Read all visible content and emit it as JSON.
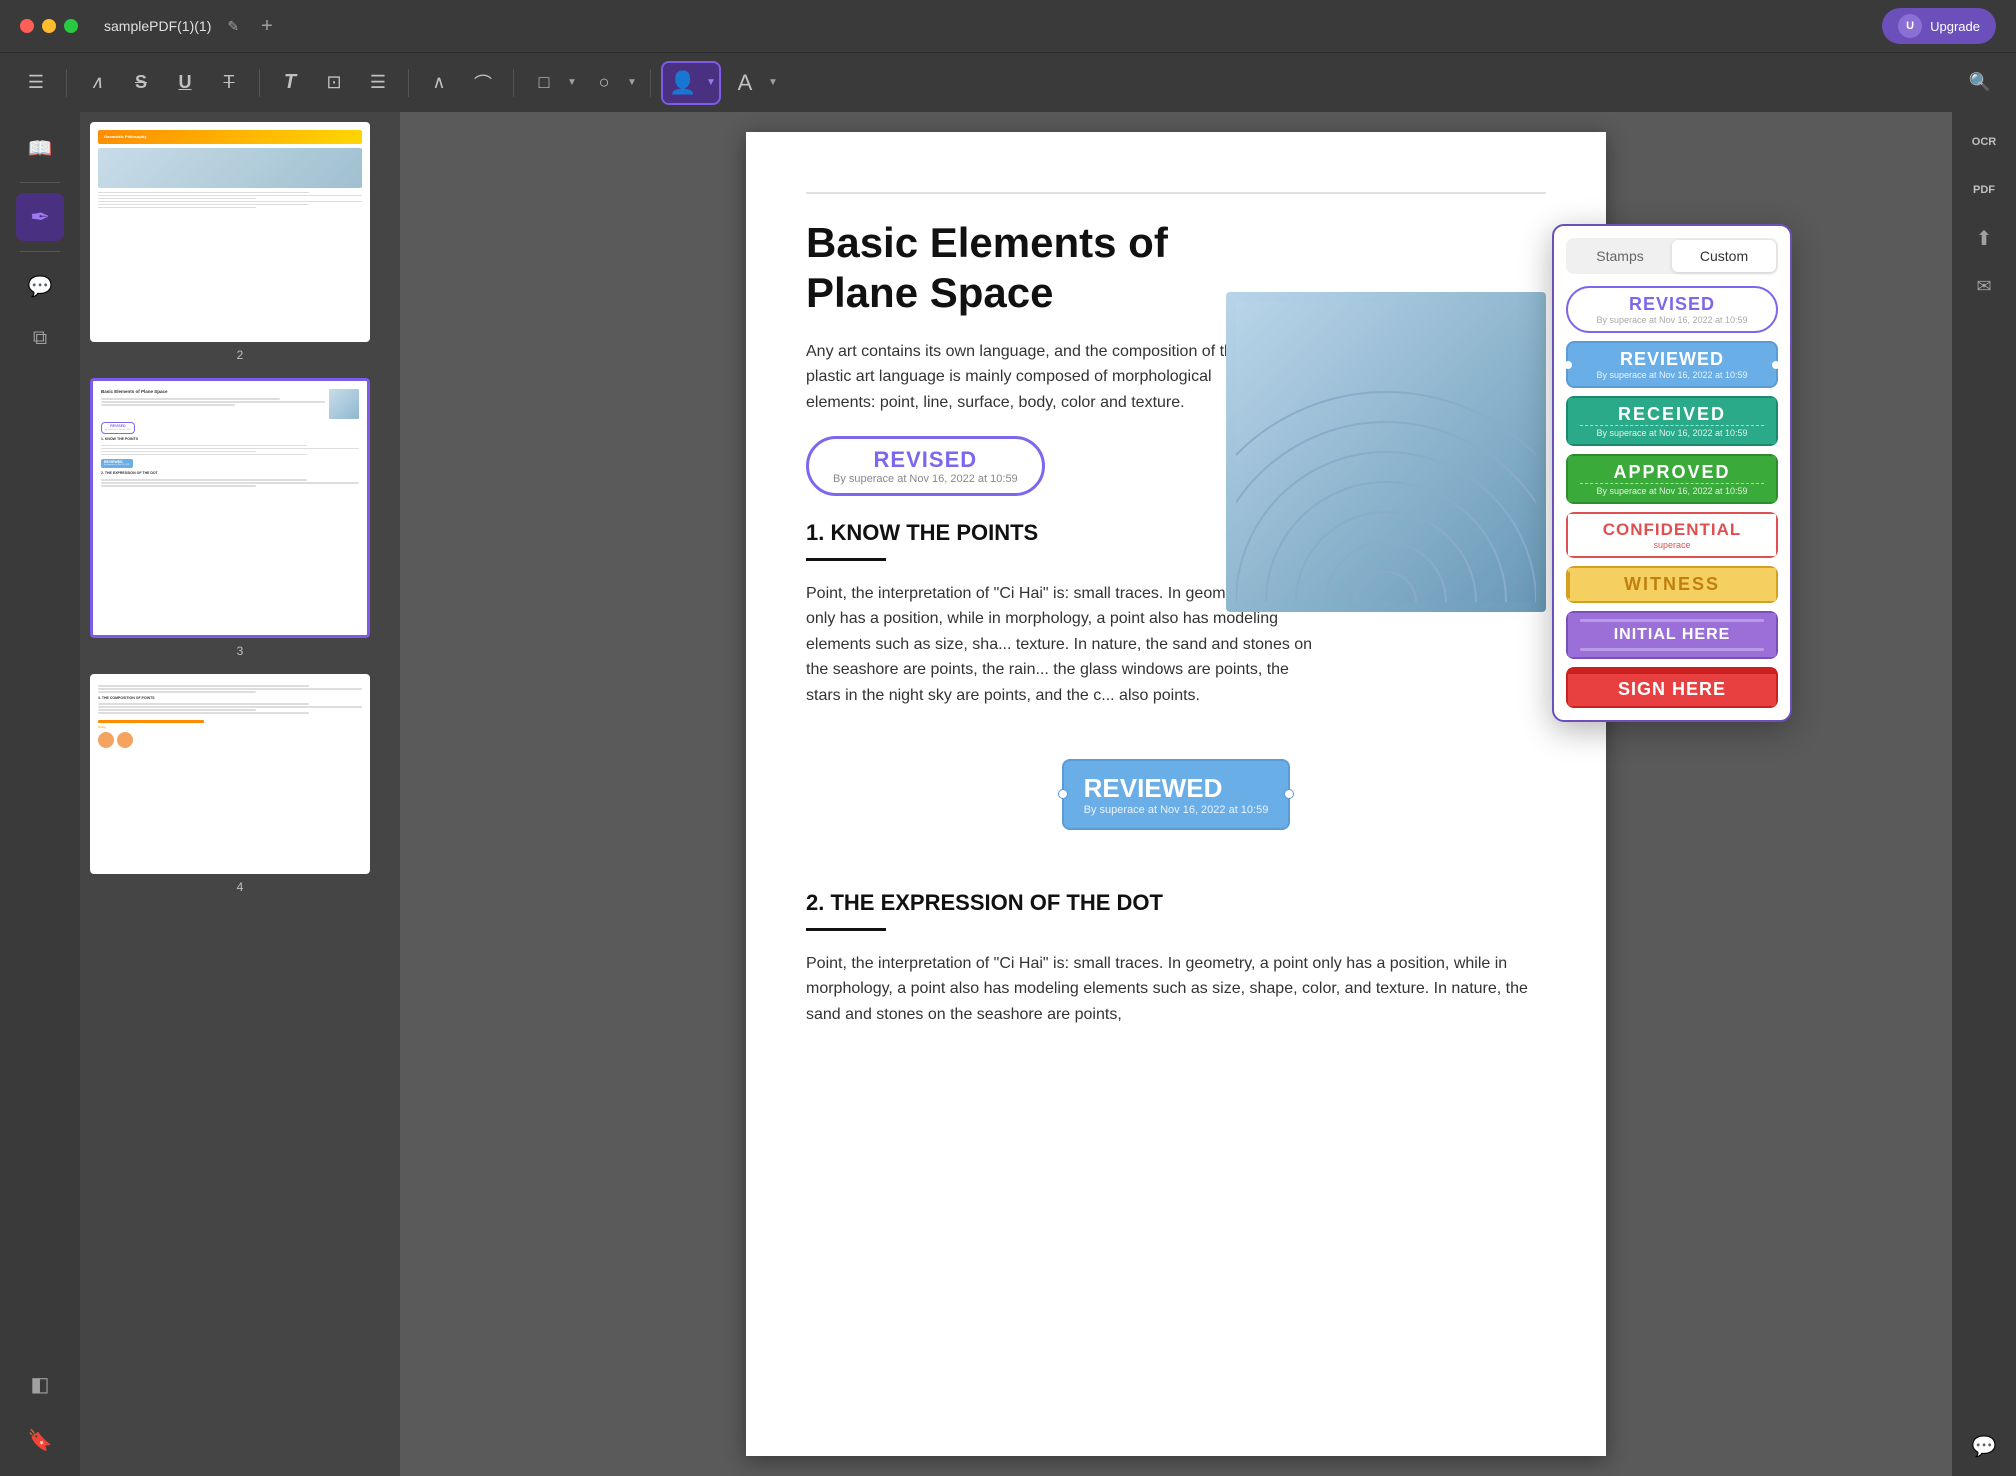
{
  "titlebar": {
    "title": "samplePDF(1)(1)",
    "edit_icon": "✎",
    "add_tab": "+",
    "upgrade_label": "Upgrade",
    "avatar_initial": "U"
  },
  "toolbar": {
    "tools": [
      {
        "name": "comment-tool",
        "icon": "☰",
        "active": false
      },
      {
        "name": "highlight-tool",
        "icon": "✏",
        "active": false
      },
      {
        "name": "strikethrough-tool",
        "icon": "S",
        "active": false
      },
      {
        "name": "underline-tool",
        "icon": "U",
        "active": false
      },
      {
        "name": "typewriter-tool",
        "icon": "T",
        "active": false
      },
      {
        "name": "text-tool",
        "icon": "T",
        "active": false
      },
      {
        "name": "textbox-tool",
        "icon": "⊡",
        "active": false
      },
      {
        "name": "note-tool",
        "icon": "≡",
        "active": false
      },
      {
        "name": "pencil-tool",
        "icon": "∧",
        "active": false
      },
      {
        "name": "shape-tool",
        "icon": "⬡",
        "active": false
      },
      {
        "name": "rectangle-tool",
        "icon": "□",
        "active": false
      },
      {
        "name": "color-tool",
        "icon": "○",
        "active": false
      },
      {
        "name": "stamp-tool",
        "icon": "👤",
        "active": true
      },
      {
        "name": "signature-tool",
        "icon": "A",
        "active": false
      },
      {
        "name": "search-tool",
        "icon": "🔍",
        "active": false
      }
    ]
  },
  "sidebar": {
    "items": [
      {
        "name": "reader-icon",
        "icon": "📖",
        "active": false
      },
      {
        "name": "highlighter-icon",
        "icon": "✒",
        "active": true
      },
      {
        "name": "comment-icon",
        "icon": "💬",
        "active": false
      },
      {
        "name": "layers-icon",
        "icon": "⧉",
        "active": false
      },
      {
        "name": "bookmark-icon",
        "icon": "🔖",
        "active": false
      }
    ]
  },
  "thumbnails": [
    {
      "page_num": "2",
      "active": false
    },
    {
      "page_num": "3",
      "active": true
    },
    {
      "page_num": "4",
      "active": false
    }
  ],
  "pdf": {
    "title": "Basic Elements of Plane Space",
    "body1": "Any art contains its own language, and the composition of the plastic art language is mainly composed of morphological elements: point, line, surface, body, color and texture.",
    "stamp_revised_title": "REVISED",
    "stamp_revised_sub": "By superace at Nov 16, 2022 at 10:59",
    "section1_title": "1. KNOW THE POINTS",
    "section1_body": "Point, the interpretation of \"Ci Hai\" is: small traces. In geometry, a point only has a position, while in morphology, a point also has modeling elements such as size, sha... texture. In nature, the sand and stones on the seashore are points, the rain... the glass windows are points, the stars in the night sky are points, and the c... also points.",
    "stamp_reviewed_title": "REVIEWED",
    "stamp_reviewed_sub": "By superace at Nov 16, 2022 at 10:59",
    "section2_title": "2. THE EXPRESSION OF THE DOT",
    "section2_body": "Point, the interpretation of \"Ci Hai\" is: small traces. In geometry, a point only has a position, while in morphology, a point also has modeling elements such as size, shape, color, and texture. In nature, the sand and stones on the seashore are points,"
  },
  "stamp_panel": {
    "tab_stamps": "Stamps",
    "tab_custom": "Custom",
    "active_tab": "Custom",
    "stamps": [
      {
        "name": "revised",
        "title": "REVISED",
        "sub": "By superace at Nov 16, 2022 at 10:59",
        "style": "revised"
      },
      {
        "name": "reviewed",
        "title": "REVIEWED",
        "sub": "By superace at Nov 16, 2022 at 10:59",
        "style": "reviewed"
      },
      {
        "name": "received",
        "title": "RECEIVED",
        "sub": "By superace at Nov 16, 2022 at 10:59",
        "style": "received"
      },
      {
        "name": "approved",
        "title": "APPROVED",
        "sub": "By superace at Nov 16, 2022 at 10:59",
        "style": "approved"
      },
      {
        "name": "confidential",
        "title": "CONFIDENTIAL",
        "sub": "superace",
        "style": "confidential"
      },
      {
        "name": "witness",
        "title": "WITNESS",
        "sub": "",
        "style": "witness"
      },
      {
        "name": "initial-here",
        "title": "INITIAL HERE",
        "sub": "",
        "style": "initial"
      },
      {
        "name": "sign-here",
        "title": "SIGN HERE",
        "sub": "",
        "style": "sign"
      }
    ]
  },
  "right_tools": {
    "icons": [
      {
        "name": "ocr-tool",
        "label": "OCR"
      },
      {
        "name": "pdf-tool",
        "label": "PDF"
      },
      {
        "name": "export-tool",
        "icon": "⬆"
      },
      {
        "name": "mail-tool",
        "icon": "✉"
      },
      {
        "name": "chat-tool",
        "icon": "💬"
      }
    ]
  }
}
